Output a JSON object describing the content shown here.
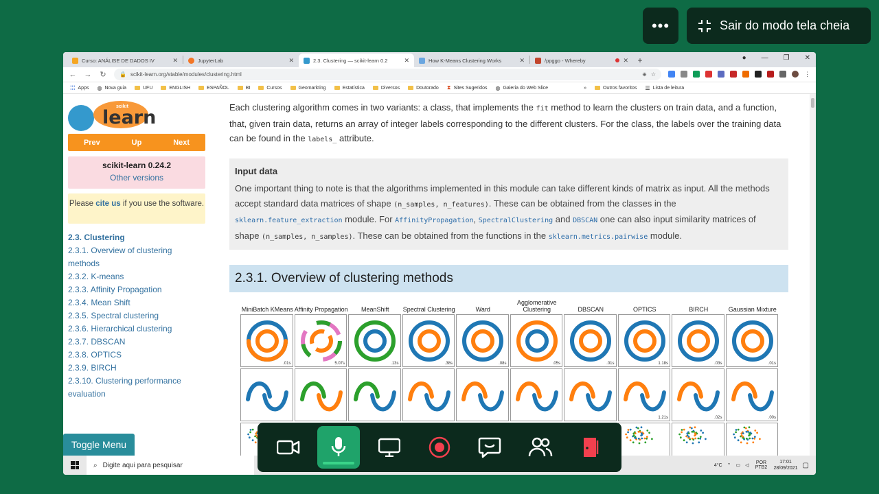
{
  "meeting": {
    "more_label": "•••",
    "exit_fullscreen_label": "Sair do modo tela cheia",
    "controls": [
      "camera",
      "microphone",
      "screen-share",
      "record",
      "chat",
      "people",
      "leave"
    ]
  },
  "browser": {
    "tabs": [
      {
        "title": "Curso: ANÁLISE DE DADOS IV",
        "fav_color": "#f5a623",
        "active": false
      },
      {
        "title": "JupyterLab",
        "fav_color": "#f37626",
        "active": false
      },
      {
        "title": "2.3. Clustering — scikit-learn 0.2",
        "fav_color": "#3499cd",
        "active": true
      },
      {
        "title": "How K-Means Clustering Works",
        "fav_color": "#6aa6e0",
        "active": false
      },
      {
        "title": "/ppggo - Whereby",
        "fav_color": "#c2452d",
        "active": false
      }
    ],
    "url": "scikit-learn.org/stable/modules/clustering.html",
    "bookmarks": [
      "Apps",
      "Nova guia",
      "UFU",
      "ENGLISH",
      "ESPAÑOL",
      "BI",
      "Cursos",
      "Geomarkting",
      "Estatística",
      "Diversos",
      "Doutorado",
      "Sites Sugeridos",
      "Galeria do Web Slice",
      "Outros favoritos",
      "Lista de leitura"
    ]
  },
  "sidebar": {
    "nav": {
      "prev": "Prev",
      "up": "Up",
      "next": "Next"
    },
    "version": "scikit-learn 0.24.2",
    "other_versions": "Other versions",
    "cite_pre": "Please ",
    "cite_link": "cite us",
    "cite_post": " if you use the software.",
    "toc": [
      "2.3. Clustering",
      "2.3.1. Overview of clustering methods",
      "2.3.2. K-means",
      "2.3.3. Affinity Propagation",
      "2.3.4. Mean Shift",
      "2.3.5. Spectral clustering",
      "2.3.6. Hierarchical clustering",
      "2.3.7. DBSCAN",
      "2.3.8. OPTICS",
      "2.3.9. BIRCH",
      "2.3.10. Clustering performance evaluation"
    ],
    "toggle_menu": "Toggle Menu"
  },
  "content": {
    "intro_1": "Each clustering algorithm comes in two variants: a class, that implements the ",
    "intro_code_1": "fit",
    "intro_2": " method to learn the clusters on train data, and a function, that, given train data, returns an array of integer labels corresponding to the different clusters. For the class, the labels over the training data can be found in the ",
    "intro_code_2": "labels_",
    "intro_3": " attribute.",
    "callout_title": "Input data",
    "callout_1": "One important thing to note is that the algorithms implemented in this module can take different kinds of matrix as input. All the methods accept standard data matrices of shape ",
    "callout_code_1": "(n_samples, n_features)",
    "callout_2": ". These can be obtained from the classes in the ",
    "callout_code_2": "sklearn.feature_extraction",
    "callout_3": " module. For ",
    "callout_code_3": "AffinityPropagation",
    "callout_sep": ", ",
    "callout_code_4": "SpectralClustering",
    "callout_4": " and ",
    "callout_code_5": "DBSCAN",
    "callout_5": " one can also input similarity matrices of shape ",
    "callout_code_6": "(n_samples, n_samples)",
    "callout_6": ". These can be obtained from the functions in the ",
    "callout_code_7": "sklearn.metrics.pairwise",
    "callout_7": " module.",
    "section_title": "2.3.1. Overview of clustering methods",
    "methods": [
      "MiniBatch KMeans",
      "Affinity Propagation",
      "MeanShift",
      "Spectral Clustering",
      "Ward",
      "Agglomerative Clustering",
      "DBSCAN",
      "OPTICS",
      "BIRCH",
      "Gaussian Mixture"
    ],
    "times_row1": [
      ".01s",
      "5.07s",
      ".13s",
      ".38s",
      ".08s",
      ".05s",
      ".01s",
      "1.18s",
      ".03s",
      ".01s"
    ],
    "times_row2": [
      "",
      "",
      "",
      "",
      "",
      "",
      "",
      "1.21s",
      ".02s",
      ".00s"
    ]
  },
  "taskbar": {
    "search_placeholder": "Digite aqui para pesquisar",
    "temp": "4°C",
    "lang": "POR PTB2",
    "time": "17:01",
    "date": "28/09/2021"
  },
  "colors": {
    "blue": "#1f77b4",
    "orange": "#ff7f0e",
    "green": "#2ca02c",
    "pink": "#e377c2"
  }
}
